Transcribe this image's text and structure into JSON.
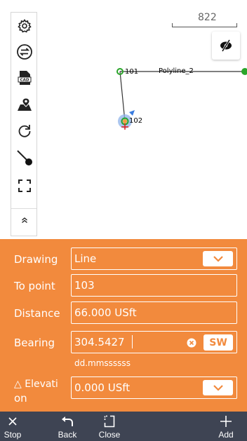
{
  "map": {
    "scale_label": "822",
    "points": [
      {
        "label": "101"
      },
      {
        "label": "102"
      }
    ],
    "polyline_label": "Polyline_2"
  },
  "toolbar": {
    "icons": [
      "gear-icon",
      "swap-icon",
      "cad-icon",
      "map-pin-icon",
      "refresh-icon",
      "line-point-icon",
      "fullscreen-icon",
      "collapse-icon"
    ]
  },
  "form": {
    "drawing_label": "Drawing",
    "drawing_value": "Line",
    "to_point_label": "To point",
    "to_point_value": "103",
    "distance_label": "Distance",
    "distance_value": "66.000 USft",
    "bearing_label": "Bearing",
    "bearing_value": "304.5427",
    "bearing_quadrant": "SW",
    "bearing_format_hint": "dd.mmssssss",
    "elevation_label_line1": "△ Elevati",
    "elevation_label_line2": "on",
    "elevation_value": "0.000 USft"
  },
  "bottom_bar": {
    "stop": "Stop",
    "back": "Back",
    "close": "Close",
    "add": "Add"
  },
  "colors": {
    "accent": "#f28a3d",
    "bottom_bar": "#3e4453",
    "point_green": "#2aa52a"
  }
}
